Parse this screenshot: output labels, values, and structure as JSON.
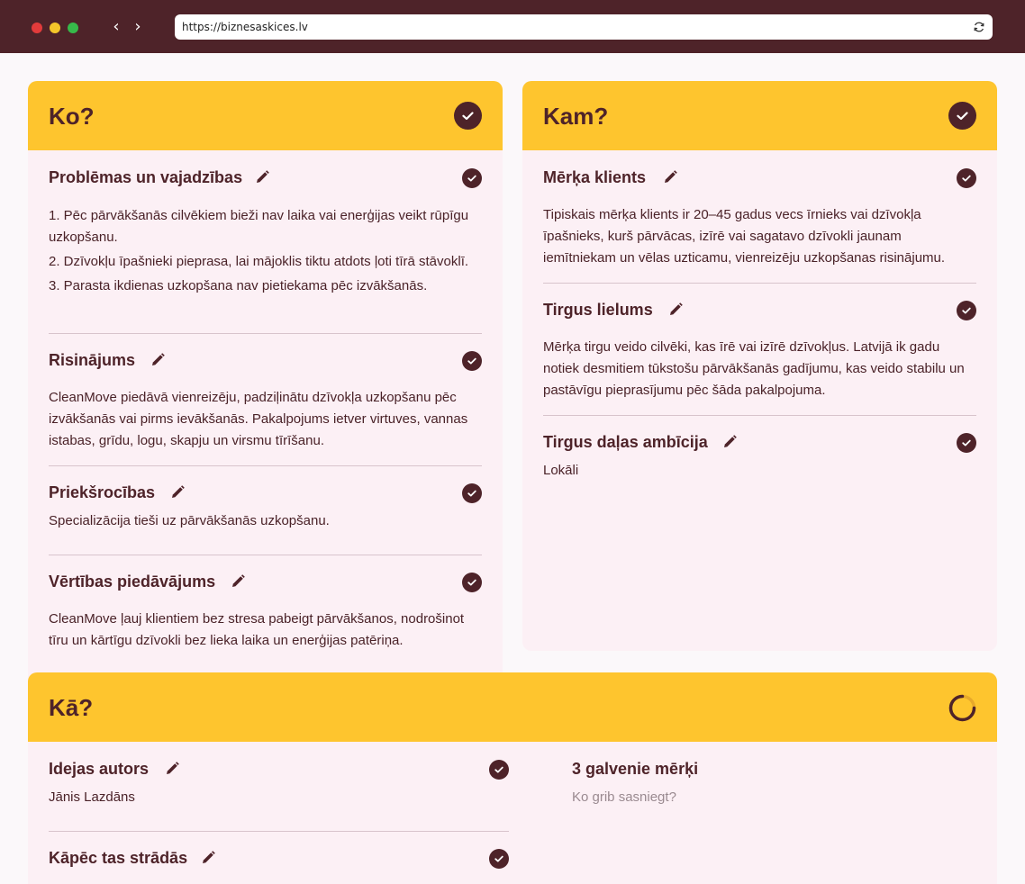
{
  "browser": {
    "url": "https://biznesaskices.lv"
  },
  "ko": {
    "title": "Ko?",
    "items": [
      {
        "title": "Problēmas un vajadzības",
        "list": [
          "1. Pēc pārvākšanās cilvēkiem bieži nav laika vai enerģijas veikt rūpīgu uzkopšanu.",
          "2. Dzīvokļu īpašnieki pieprasa, lai mājoklis tiktu atdots ļoti tīrā stāvoklī.",
          "3. Parasta ikdienas uzkopšana nav pietiekama pēc izvākšanās."
        ]
      },
      {
        "title": "Risinājums",
        "text": "CleanMove piedāvā vienreizēju, padziļinātu dzīvokļa uzkopšanu pēc izvākšanās vai pirms ievākšanās. Pakalpojums ietver virtuves, vannas istabas, grīdu, logu, skapju un virsmu tīrīšanu."
      },
      {
        "title": "Priekšrocības",
        "text": "Specializācija tieši uz pārvākšanās uzkopšanu."
      },
      {
        "title": "Vērtības piedāvājums",
        "text": "CleanMove ļauj klientiem bez stresa pabeigt pārvākšanos, nodrošinot tīru un kārtīgu dzīvokli bez lieka laika un enerģijas patēriņa."
      }
    ]
  },
  "kam": {
    "title": "Kam?",
    "items": [
      {
        "title": "Mērķa klients",
        "text": "Tipiskais mērķa klients ir 20–45 gadus vecs īrnieks vai dzīvokļa īpašnieks, kurš pārvācas, izīrē vai sagatavo dzīvokli jaunam iemītniekam un vēlas uzticamu, vienreizēju uzkopšanas risinājumu."
      },
      {
        "title": "Tirgus lielums",
        "text": "Mērķa tirgu veido cilvēki, kas īrē vai izīrē dzīvokļus. Latvijā ik gadu notiek desmitiem tūkstošu pārvākšanās gadījumu, kas veido stabilu un pastāvīgu pieprasījumu pēc šāda pakalpojuma."
      },
      {
        "title": "Tirgus daļas ambīcija",
        "text": "Lokāli"
      }
    ]
  },
  "ka": {
    "title": "Kā?",
    "items": [
      {
        "title": "Idejas autors",
        "text": "Jānis Lazdāns"
      },
      {
        "title": "Kāpēc tas strādās",
        "text": ""
      }
    ],
    "goals": {
      "title": "3 galvenie mērķi",
      "placeholder": "Ko grib sasniegt?"
    }
  }
}
